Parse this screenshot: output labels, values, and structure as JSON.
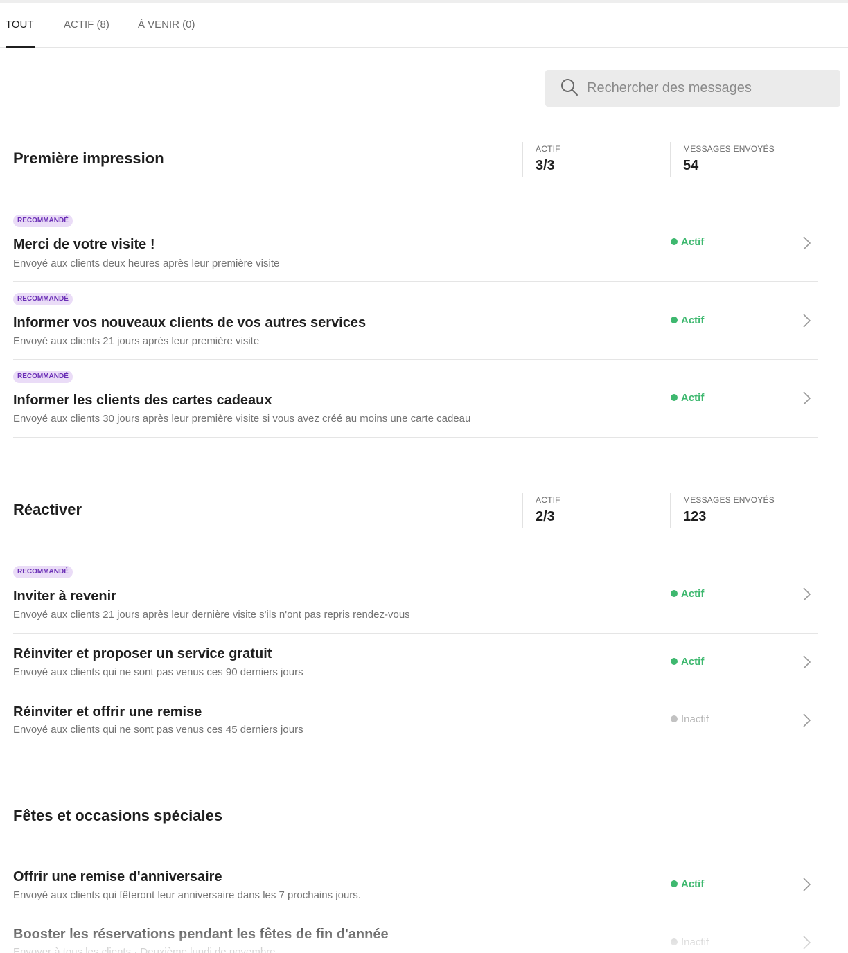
{
  "tabs": [
    {
      "label": "TOUT"
    },
    {
      "label": "ACTIF (8)"
    },
    {
      "label": "À VENIR (0)"
    }
  ],
  "search": {
    "placeholder": "Rechercher des messages",
    "icon": "search-icon"
  },
  "colors": {
    "active_green": "#3eb86f",
    "inactive_gray": "#b5b5b5",
    "badge_purple": "#6b2fb6",
    "badge_bg": "#eadcf7"
  },
  "sections": [
    {
      "title": "Première impression",
      "stats": [
        {
          "label": "ACTIF",
          "value": "3/3"
        },
        {
          "label": "MESSAGES ENVOYÉS",
          "value": "54"
        }
      ],
      "rows": [
        {
          "badge": "RECOMMANDÉ",
          "title": "Merci de votre visite !",
          "desc": "Envoyé aux clients deux heures après leur première visite",
          "status": "Actif"
        },
        {
          "badge": "RECOMMANDÉ",
          "title": "Informer vos nouveaux clients de vos autres services",
          "desc": "Envoyé aux clients 21 jours après leur première visite",
          "status": "Actif"
        },
        {
          "badge": "RECOMMANDÉ",
          "title": "Informer les clients des cartes cadeaux",
          "desc": "Envoyé aux clients 30 jours après leur première visite si vous avez créé au moins une carte cadeau",
          "status": "Actif"
        }
      ]
    },
    {
      "title": "Réactiver",
      "stats": [
        {
          "label": "ACTIF",
          "value": "2/3"
        },
        {
          "label": "MESSAGES ENVOYÉS",
          "value": "123"
        }
      ],
      "rows": [
        {
          "badge": "RECOMMANDÉ",
          "title": "Inviter à revenir",
          "desc": "Envoyé aux clients 21 jours après leur dernière visite s'ils n'ont pas repris rendez-vous",
          "status": "Actif"
        },
        {
          "title": "Réinviter et proposer un service gratuit",
          "desc": "Envoyé aux clients qui ne sont pas venus ces 90 derniers jours",
          "status": "Actif"
        },
        {
          "title": "Réinviter et offrir une remise",
          "desc": "Envoyé aux clients qui ne sont pas venus ces 45 derniers jours",
          "status": "Inactif"
        }
      ]
    },
    {
      "title": "Fêtes et occasions spéciales",
      "rows": [
        {
          "title": "Offrir une remise d'anniversaire",
          "desc": "Envoyé aux clients qui fêteront leur anniversaire dans les 7 prochains jours.",
          "status": "Actif"
        },
        {
          "title": "Booster les réservations pendant les fêtes de fin d'année",
          "desc": "Envoyer à tous les clients · Deuxième lundi de novembre",
          "status": "Inactif"
        }
      ]
    }
  ]
}
